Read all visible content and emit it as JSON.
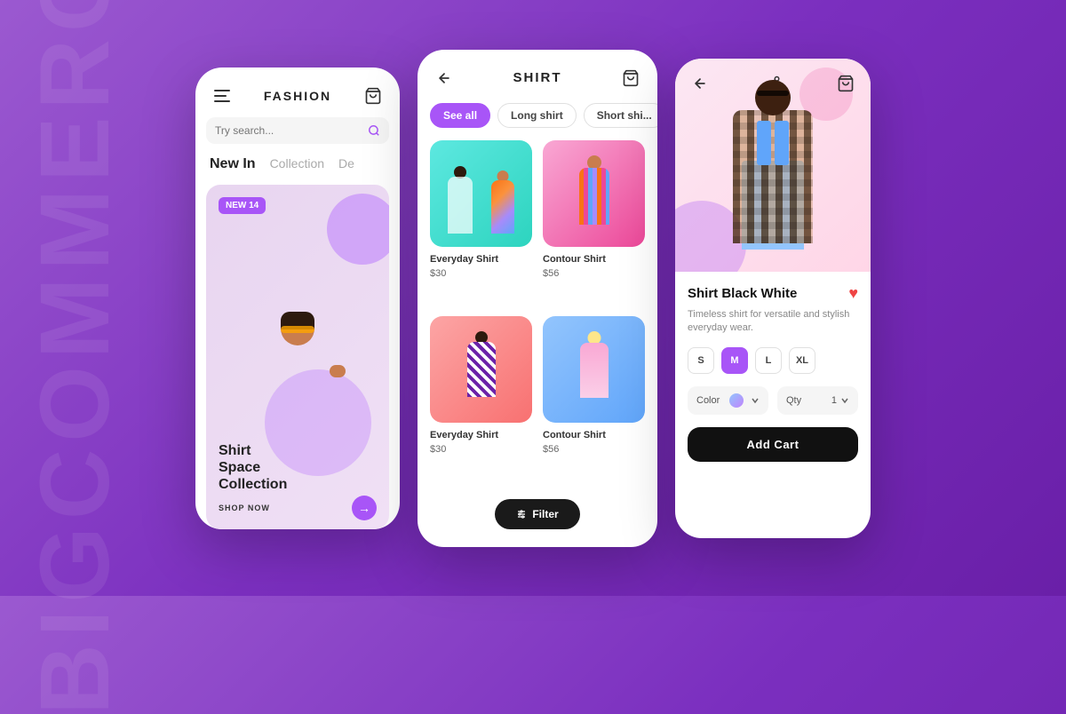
{
  "background": {
    "brand_text": "BIGCOMMERCE"
  },
  "phone1": {
    "header": {
      "title": "FASHION"
    },
    "search": {
      "placeholder": "Try search..."
    },
    "nav": {
      "items": [
        {
          "label": "New In",
          "active": true
        },
        {
          "label": "Collection",
          "active": false
        },
        {
          "label": "De",
          "active": false
        }
      ]
    },
    "banner": {
      "badge": "NEW 14",
      "title": "Shirt\nSpace\nCollection",
      "shop_label": "SHOP NOW",
      "arrow": "→"
    }
  },
  "phone2": {
    "header": {
      "title": "SHIRT"
    },
    "filters": [
      {
        "label": "See all",
        "active": true
      },
      {
        "label": "Long shirt",
        "active": false
      },
      {
        "label": "Short shi...",
        "active": false
      }
    ],
    "products": [
      {
        "name": "Everyday Shirt",
        "price": "$30",
        "bg": "teal"
      },
      {
        "name": "Contour Shirt",
        "price": "$56",
        "bg": "pink"
      },
      {
        "name": "Everyday Shirt",
        "price": "$30",
        "bg": "pink2"
      },
      {
        "name": "Contour Shirt",
        "price": "$56",
        "bg": "blue"
      }
    ],
    "filter_button": "Filter"
  },
  "phone3": {
    "product": {
      "name": "Shirt Black White",
      "description": "Timeless shirt for versatile and stylish everyday wear.",
      "sizes": [
        "S",
        "M",
        "L",
        "XL"
      ],
      "active_size": "M",
      "color_label": "Color",
      "qty_label": "Qty",
      "qty_value": "1",
      "add_cart_label": "Add Cart"
    }
  }
}
